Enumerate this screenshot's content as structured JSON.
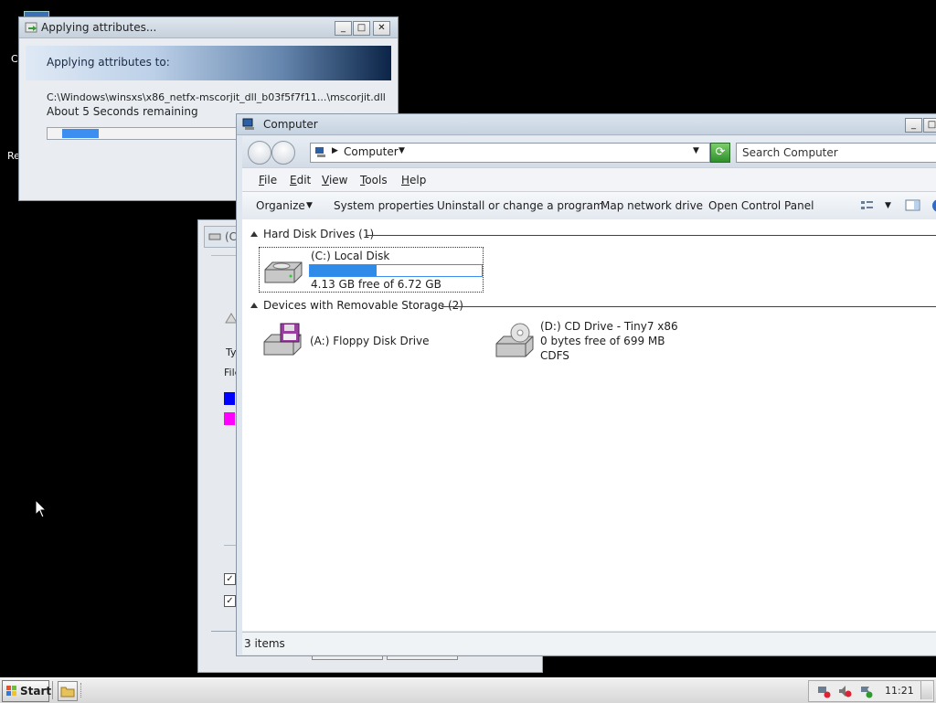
{
  "desktop": {
    "icon_labels": [
      "C",
      "Re"
    ]
  },
  "apply_dialog": {
    "title": "Applying attributes...",
    "banner_text": "Applying attributes to:",
    "path": "C:\\Windows\\winsxs\\x86_netfx-mscorjit_dll_b03f5f7f11...\\mscorjit.dll",
    "remaining": "About 5 Seconds remaining",
    "progress_fraction": 0.2
  },
  "bg_window": {
    "title_fragment": "(C",
    "label_1": "Ty",
    "label_2": "File",
    "used_color": "#0000ff",
    "free_color": "#ff00ff"
  },
  "computer": {
    "title": "Computer",
    "address_text": "Computer",
    "search_placeholder": "Search Computer",
    "menu": [
      "File",
      "Edit",
      "View",
      "Tools",
      "Help"
    ],
    "commands": {
      "organize": "Organize",
      "system_properties": "System properties",
      "uninstall": "Uninstall or change a program",
      "map_drive": "Map network drive",
      "control_panel": "Open Control Panel"
    },
    "groups": {
      "hdd_header": "Hard Disk Drives (1)",
      "removable_header": "Devices with Removable Storage (2)"
    },
    "drives": {
      "c_name": "(C:) Local Disk",
      "c_free": "4.13 GB free of 6.72 GB",
      "c_used_fraction": 0.39,
      "a_name": "(A:) Floppy Disk Drive",
      "d_name": "(D:) CD Drive - Tiny7 x86",
      "d_free": "0 bytes free of 699 MB",
      "d_fs": "CDFS"
    },
    "status_items": "3 items"
  },
  "taskbar": {
    "start_label": "Start",
    "clock": "11:21"
  },
  "colors": {
    "progress": "#3c8ff0",
    "link": "#1e1e1e"
  }
}
